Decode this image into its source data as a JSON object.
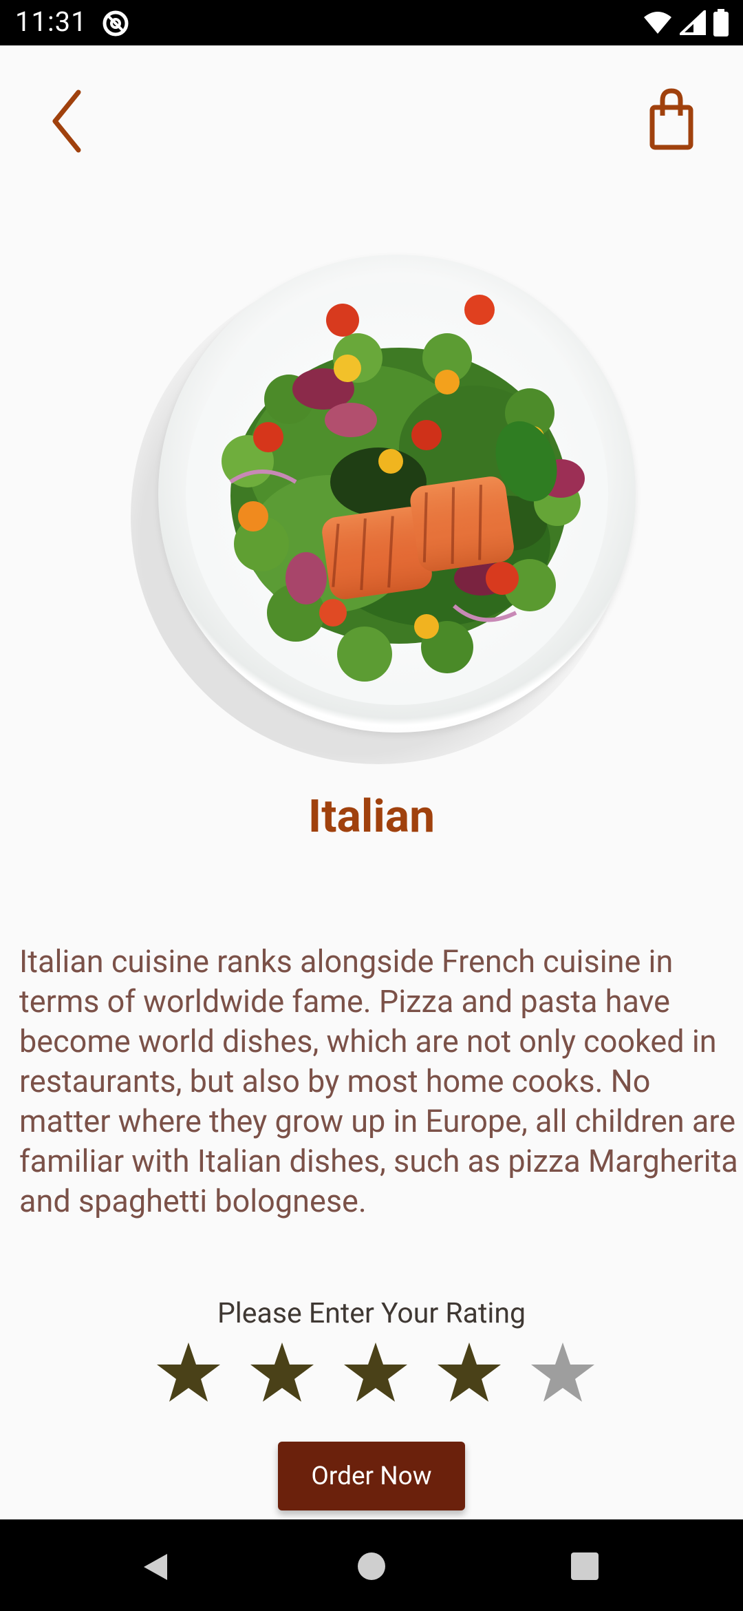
{
  "status_bar": {
    "time": "11:31",
    "icons": [
      "at-sign-icon",
      "wifi-icon",
      "signal-icon",
      "battery-icon"
    ]
  },
  "nav": {
    "back_icon": "chevron-left-icon",
    "cart_icon": "shopping-bag-icon"
  },
  "dish": {
    "image_subject": "salmon salad on white plate",
    "title": "Italian",
    "description": "Italian cuisine ranks alongside French cuisine in terms of worldwide fame. Pizza and pasta have become world dishes, which are not only cooked in restaurants, but also by most home cooks. No matter where they grow up in Europe, all children are familiar with Italian dishes, such as pizza Margherita and spaghetti bolognese."
  },
  "rating": {
    "label": "Please Enter Your Rating",
    "value": 4,
    "max": 5,
    "filled_color": "#4a4118",
    "empty_color": "#9e9e9e"
  },
  "order": {
    "label": "Order Now"
  },
  "colors": {
    "accent": "#a0410d",
    "button": "#6b210c",
    "text": "#7b5148"
  }
}
